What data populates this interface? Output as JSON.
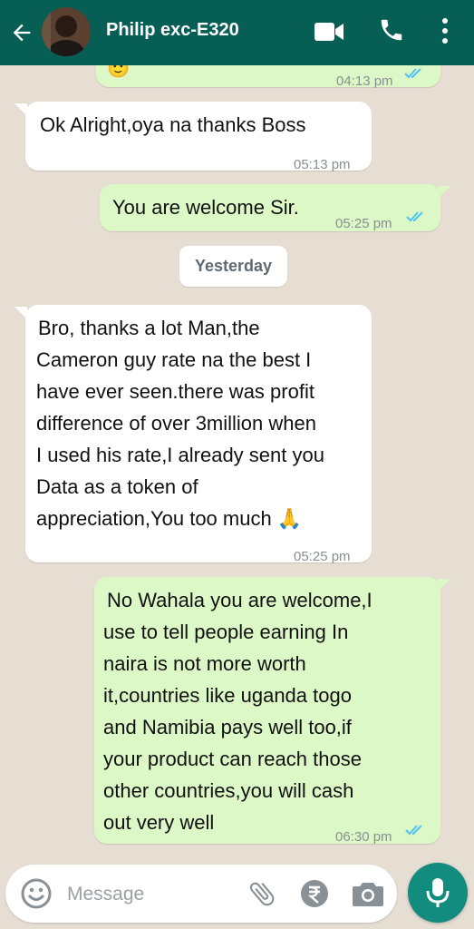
{
  "header": {
    "contact_name": "Philip exc-E320"
  },
  "messages": [
    {
      "direction": "out",
      "lines": [
        "🙂"
      ],
      "time": "04:13 pm",
      "read": true
    },
    {
      "direction": "in",
      "lines": [
        "Ok Alright,oya na thanks Boss"
      ],
      "time": "05:13 pm"
    },
    {
      "direction": "out",
      "lines": [
        "You are welcome Sir."
      ],
      "time": "05:25 pm",
      "read": true
    },
    {
      "direction": "in",
      "lines": [
        "Bro, thanks a lot Man,the",
        "Cameron guy rate na the best I",
        "have ever seen.there was profit",
        "difference of over 3million when",
        "I used his rate,I already sent you",
        "Data as a token of",
        "appreciation,You too much 🙏"
      ],
      "time": "05:25 pm"
    },
    {
      "direction": "out",
      "lines": [
        "No Wahala you are welcome,I",
        "use to tell people earning In",
        "naira is not more worth",
        "it,countries like uganda togo",
        "and Namibia pays well too,if",
        "your product can reach those",
        "other countries,you will cash",
        "out very well"
      ],
      "time": "06:30 pm",
      "read": true
    }
  ],
  "date_divider": "Yesterday",
  "composer": {
    "placeholder": "Message"
  },
  "colors": {
    "header": "#075e54",
    "chat_background": "#e6ddd3",
    "incoming_bubble": "#ffffff",
    "outgoing_bubble": "#dcf8c6",
    "read_ticks": "#4fc3f7",
    "mic_button": "#128c7e"
  },
  "icons": [
    "back-arrow-icon",
    "video-call-icon",
    "phone-icon",
    "more-options-icon",
    "emoji-icon",
    "attach-icon",
    "rupee-payment-icon",
    "camera-icon",
    "mic-icon"
  ]
}
